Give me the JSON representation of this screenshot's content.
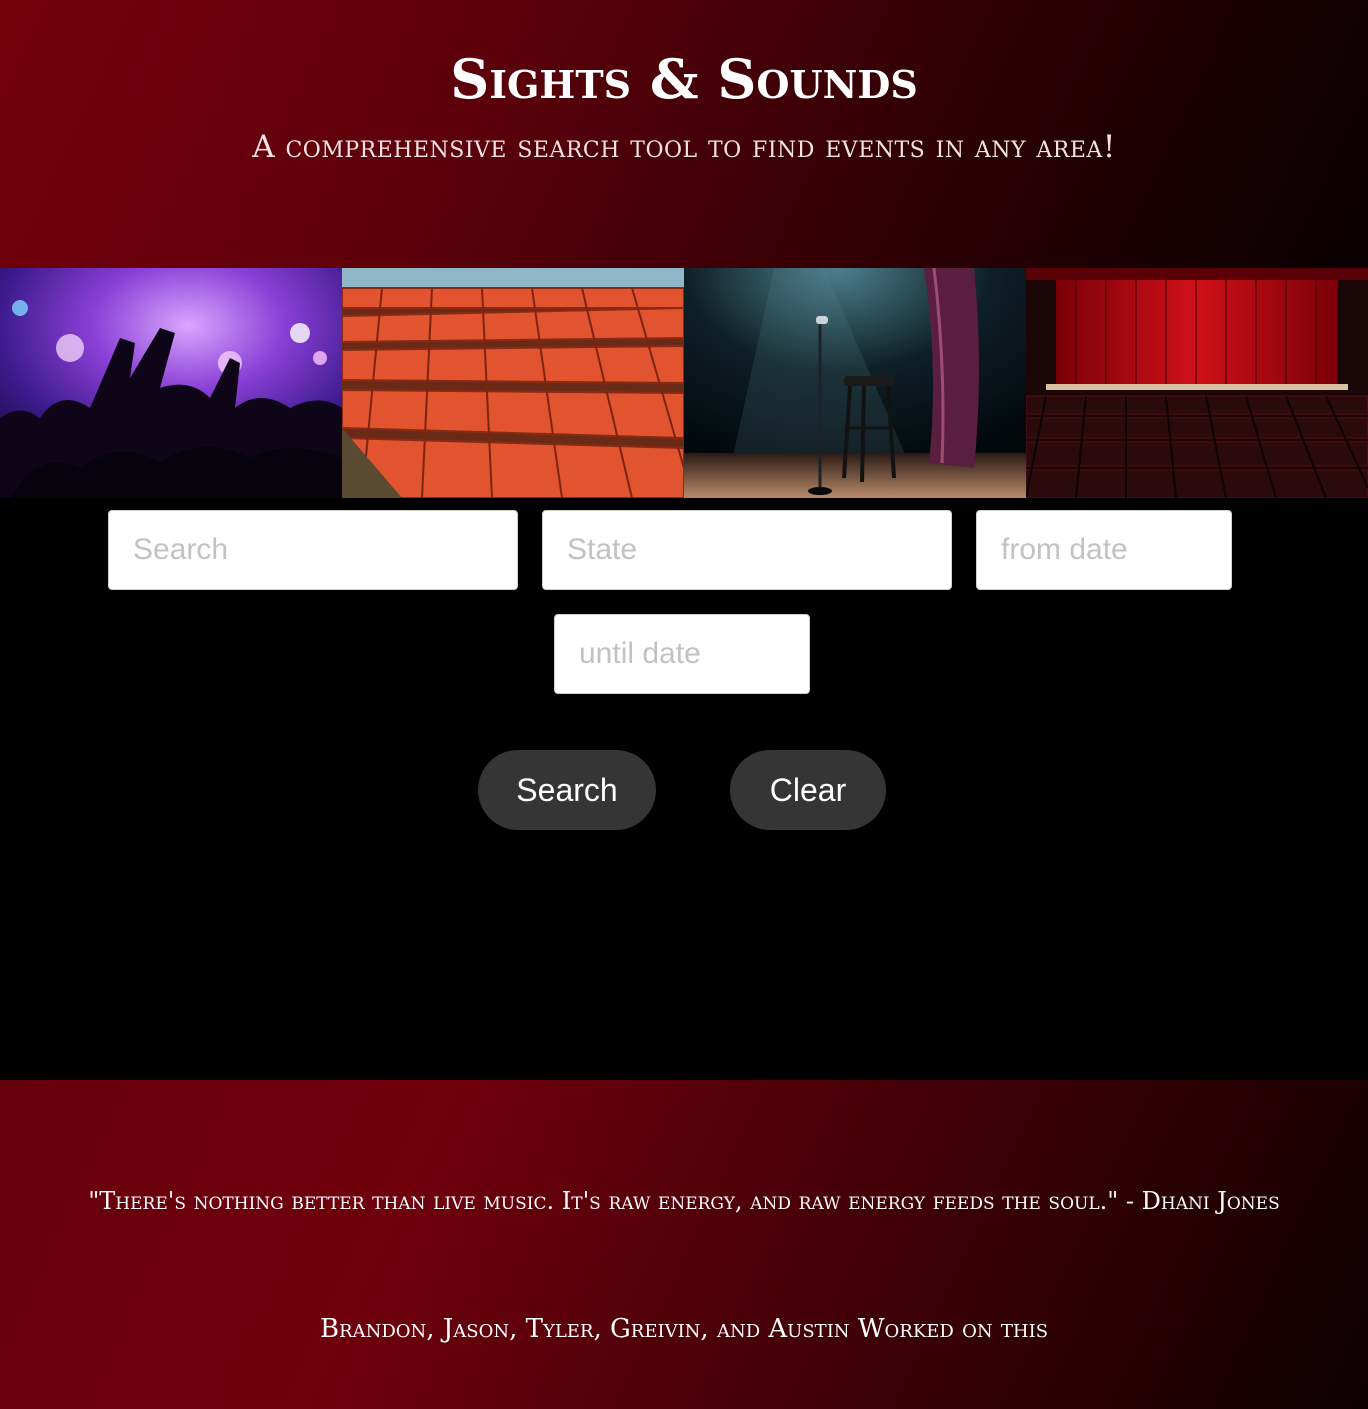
{
  "header": {
    "title": "Sights & Sounds",
    "tagline": "A comprehensive search tool to find events in any area!"
  },
  "gallery": [
    {
      "name": "concert-crowd-photo",
      "icon": "concert-crowd"
    },
    {
      "name": "stadium-seats-photo",
      "icon": "stadium-seats"
    },
    {
      "name": "comedy-stage-photo",
      "icon": "microphone-stool-stage"
    },
    {
      "name": "theater-curtain-photo",
      "icon": "theater-auditorium"
    }
  ],
  "search": {
    "keyword_placeholder": "Search",
    "state_placeholder": "State",
    "from_date_placeholder": "from date",
    "until_date_placeholder": "until date",
    "search_label": "Search",
    "clear_label": "Clear"
  },
  "footer": {
    "quote": "\"There's nothing better than live music. It's raw energy, and raw energy feeds the soul.\" - Dhani Jones",
    "credits": "Brandon, Jason, Tyler, Greivin, and Austin Worked on this"
  },
  "colors": {
    "header_red": "#75000c",
    "button_bg": "#353535",
    "page_bg": "#000000"
  }
}
